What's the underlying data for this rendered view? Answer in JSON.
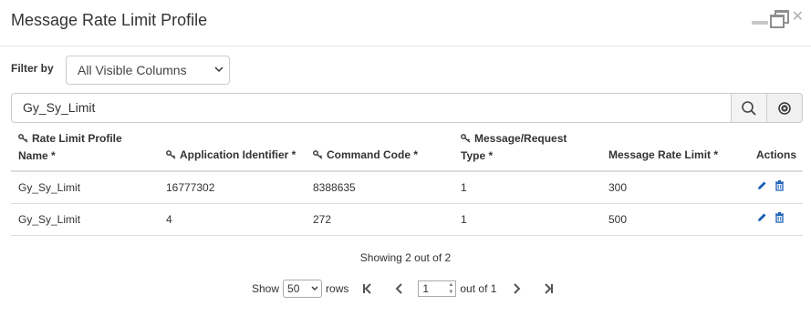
{
  "dialog": {
    "title": "Message Rate Limit Profile"
  },
  "filter": {
    "label": "Filter by",
    "selected": "All Visible Columns"
  },
  "search": {
    "value": "Gy_Sy_Limit"
  },
  "table": {
    "headers": {
      "col1_line1": "Rate Limit Profile",
      "col1_line2": "Name *",
      "col2": "Application Identifier *",
      "col3": "Command Code *",
      "col4_line1": "Message/Request",
      "col4_line2": "Type *",
      "col5": "Message Rate Limit *",
      "col6": "Actions"
    },
    "rows": [
      {
        "name": "Gy_Sy_Limit",
        "app_id": "16777302",
        "cmd_code": "8388635",
        "msg_type": "1",
        "rate_limit": "300"
      },
      {
        "name": "Gy_Sy_Limit",
        "app_id": "4",
        "cmd_code": "272",
        "msg_type": "1",
        "rate_limit": "500"
      }
    ]
  },
  "footer": {
    "showing": "Showing 2 out of 2",
    "show_label": "Show",
    "rows_value": "50",
    "rows_label": "rows",
    "page_value": "1",
    "out_of": "out of 1"
  },
  "colors": {
    "icon_blue": "#1a5fb4",
    "border": "#cccccc"
  }
}
